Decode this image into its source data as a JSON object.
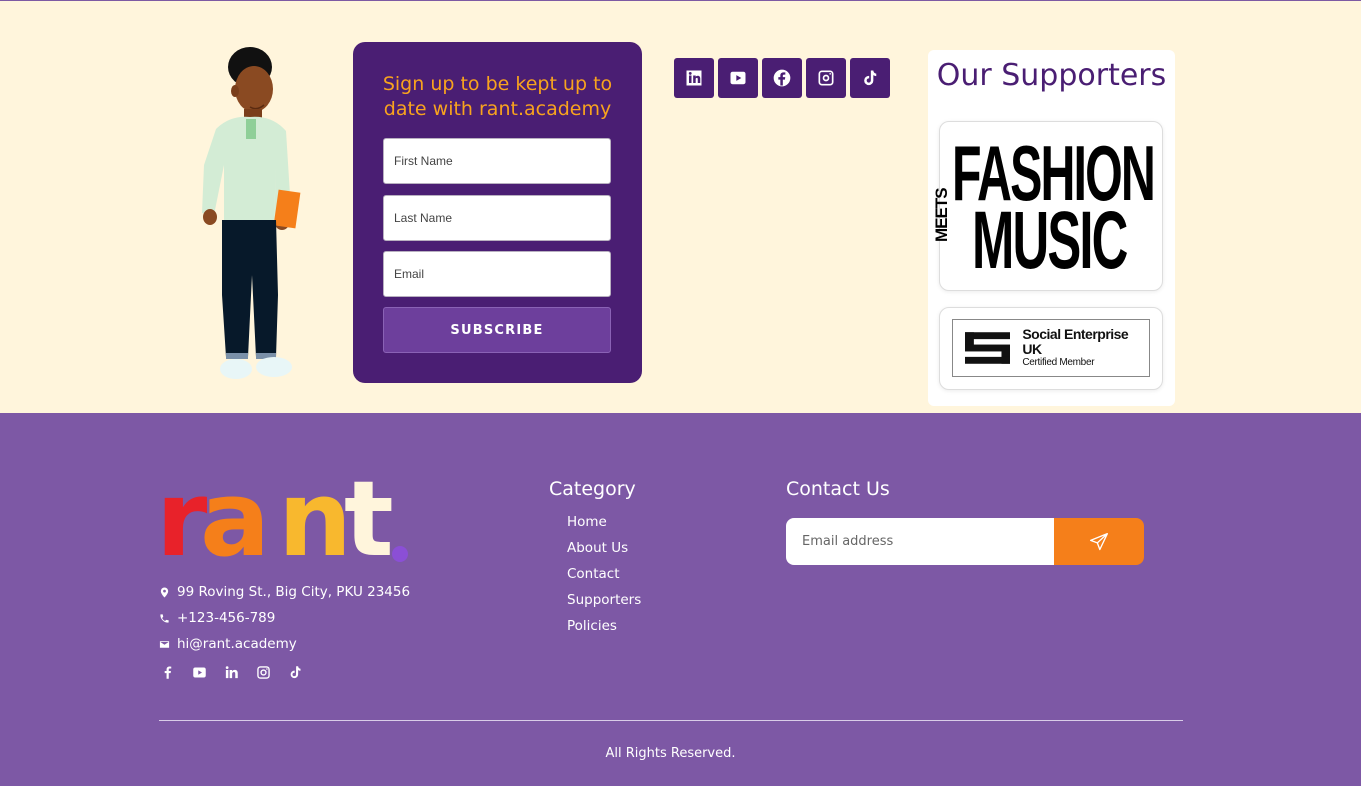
{
  "signup": {
    "title": "Sign up to be kept up to date with rant.academy",
    "first_name_placeholder": "First Name",
    "last_name_placeholder": "Last Name",
    "email_placeholder": "Email",
    "subscribe_label": "SUBSCRIBE"
  },
  "social_top": [
    "linkedin-icon",
    "youtube-icon",
    "facebook-icon",
    "instagram-icon",
    "tiktok-icon"
  ],
  "supporters": {
    "title": "Our Supporters",
    "fashion_logo": {
      "line1": "FASHION",
      "side": "MEETS",
      "line2": "MUSIC"
    },
    "seuk_logo": {
      "line1": "Social Enterprise UK",
      "line2": "Certified Member"
    }
  },
  "footer": {
    "brand": {
      "letters": [
        "r",
        "a",
        "n",
        "t"
      ]
    },
    "address": "99 Roving St., Big City, PKU 23456",
    "phone": "+123-456-789",
    "email": "hi@rant.academy",
    "social": [
      "facebook-icon",
      "youtube-icon",
      "linkedin-icon",
      "instagram-icon",
      "tiktok-icon"
    ],
    "category": {
      "title": "Category",
      "items": [
        "Home",
        "About Us",
        "Contact",
        "Supporters",
        "Policies"
      ]
    },
    "contact": {
      "title": "Contact Us",
      "placeholder": "Email address"
    },
    "copyright": "All Rights Reserved."
  },
  "colors": {
    "cream": "#fff5dc",
    "purple_dark": "#4a1e73",
    "purple_footer": "#7d58a5",
    "orange": "#f57f1a",
    "yellow_title": "#f8a31e",
    "brand_r": "#e8222a",
    "brand_a": "#f57f1a",
    "brand_n": "#f8b82e",
    "brand_t": "#fff5dc"
  }
}
